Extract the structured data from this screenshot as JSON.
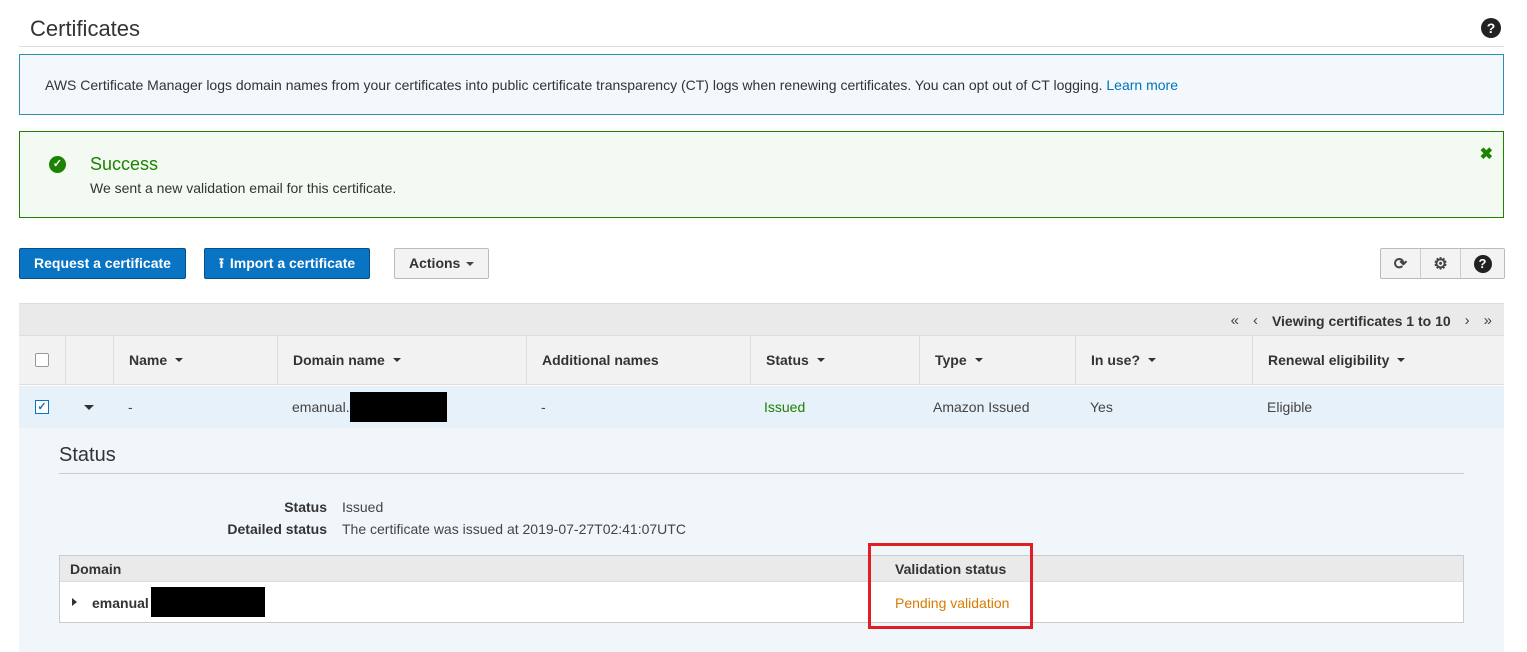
{
  "page": {
    "title": "Certificates"
  },
  "info_banner": {
    "text": "AWS Certificate Manager logs domain names from your certificates into public certificate transparency (CT) logs when renewing certificates. You can opt out of CT logging. ",
    "link": "Learn more"
  },
  "success_banner": {
    "title": "Success",
    "message": "We sent a new validation email for this certificate.",
    "close": "✖"
  },
  "toolbar": {
    "request": "Request a certificate",
    "import": "Import a certificate",
    "actions": "Actions"
  },
  "pager": {
    "first": "«",
    "prev": "‹",
    "label": "Viewing certificates 1 to 10",
    "next": "›",
    "last": "»"
  },
  "table": {
    "columns": [
      "Name",
      "Domain name",
      "Additional names",
      "Status",
      "Type",
      "In use?",
      "Renewal eligibility"
    ],
    "row": {
      "name": "-",
      "domain": "emanual.",
      "additional": "-",
      "status": "Issued",
      "type": "Amazon Issued",
      "in_use": "Yes",
      "renewal": "Eligible"
    }
  },
  "detail": {
    "title": "Status",
    "status_label": "Status",
    "status_value": "Issued",
    "detailed_label": "Detailed status",
    "detailed_value": "The certificate was issued at 2019-07-27T02:41:07UTC",
    "domain_header": "Domain",
    "validation_header": "Validation status",
    "domain_value": "emanual",
    "validation_value": "Pending validation"
  },
  "colors": {
    "primary": "#0973c4",
    "success": "#1d8102",
    "pending": "#d97b00",
    "highlight": "#e01e26"
  }
}
